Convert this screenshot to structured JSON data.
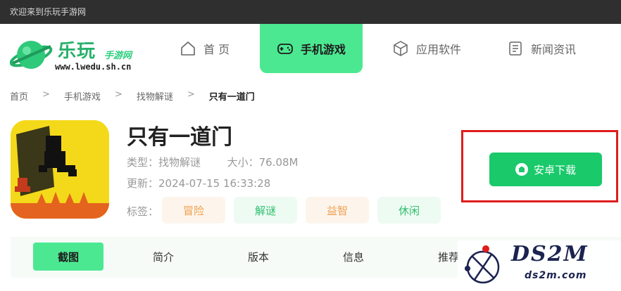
{
  "topbar": {
    "welcome": "欢迎来到乐玩手游网"
  },
  "logo": {
    "title": "乐玩",
    "subtitle": "手游网",
    "url": "www.lwedu.sh.cn"
  },
  "nav": {
    "items": [
      {
        "label": "首 页",
        "icon": "home-icon"
      },
      {
        "label": "手机游戏",
        "icon": "gamepad-icon",
        "active": true
      },
      {
        "label": "应用软件",
        "icon": "cube-icon"
      },
      {
        "label": "新闻资讯",
        "icon": "news-icon"
      }
    ],
    "active_color": "#4ce891"
  },
  "breadcrumb": {
    "items": [
      "首页",
      "手机游戏",
      "找物解谜",
      "只有一道门"
    ],
    "separator": ">"
  },
  "app": {
    "title": "只有一道门",
    "type_label": "类型：",
    "type_value": "找物解谜",
    "size_label": "大小：",
    "size_value": "76.08M",
    "update_label": "更新：",
    "update_value": "2024-07-15 16:33:28",
    "tags_label": "标签：",
    "tags": [
      {
        "label": "冒险",
        "bg": "#fdf5ec",
        "color": "#f0a050"
      },
      {
        "label": "解谜",
        "bg": "#eefbf3",
        "color": "#2fbf6e"
      },
      {
        "label": "益智",
        "bg": "#fdf5ec",
        "color": "#f0a050"
      },
      {
        "label": "休闲",
        "bg": "#eefbf3",
        "color": "#2fbf6e"
      }
    ]
  },
  "download": {
    "label": "安卓下载",
    "icon": "android-icon",
    "color": "#19c96a",
    "frame_color": "#e01c1c"
  },
  "tabs": [
    {
      "label": "截图",
      "active": true
    },
    {
      "label": "简介"
    },
    {
      "label": "版本"
    },
    {
      "label": "信息"
    },
    {
      "label": "推荐"
    }
  ],
  "watermark": {
    "big": "DS2M",
    "small": "ds2m.com"
  }
}
